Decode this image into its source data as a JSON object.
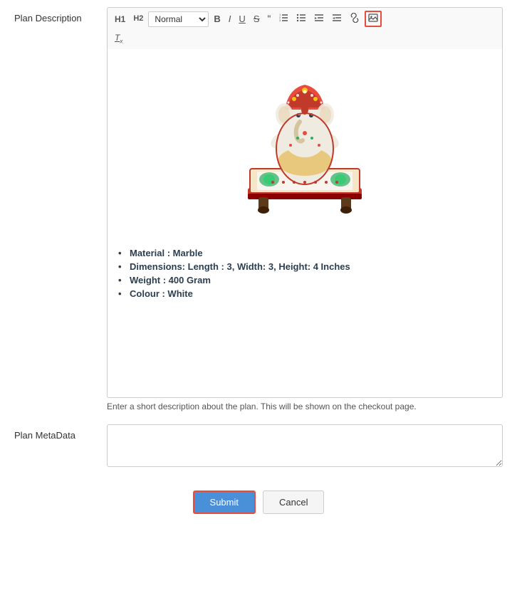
{
  "form": {
    "label_description": "Plan Description",
    "label_metadata": "Plan MetaData",
    "helper_text": "Enter a short description about the plan. This will be shown on the checkout page.",
    "toolbar": {
      "h1_label": "H1",
      "h2_label": "H2",
      "format_default": "Normal",
      "bold_icon": "B",
      "italic_icon": "I",
      "underline_icon": "U",
      "strikethrough_icon": "S",
      "quote_icon": "”",
      "ordered_list_icon": "≡",
      "unordered_list_icon": "≡",
      "indent_icon": "≡",
      "outdent_icon": "≡",
      "link_icon": "🔗",
      "image_icon": "🖼",
      "clear_format_icon": "Tx"
    },
    "bullets": [
      "Material : Marble",
      "Dimensions: Length : 3, Width: 3, Height: 4 Inches",
      "Weight : 400 Gram",
      "Colour : White"
    ],
    "buttons": {
      "submit": "Submit",
      "cancel": "Cancel"
    }
  }
}
